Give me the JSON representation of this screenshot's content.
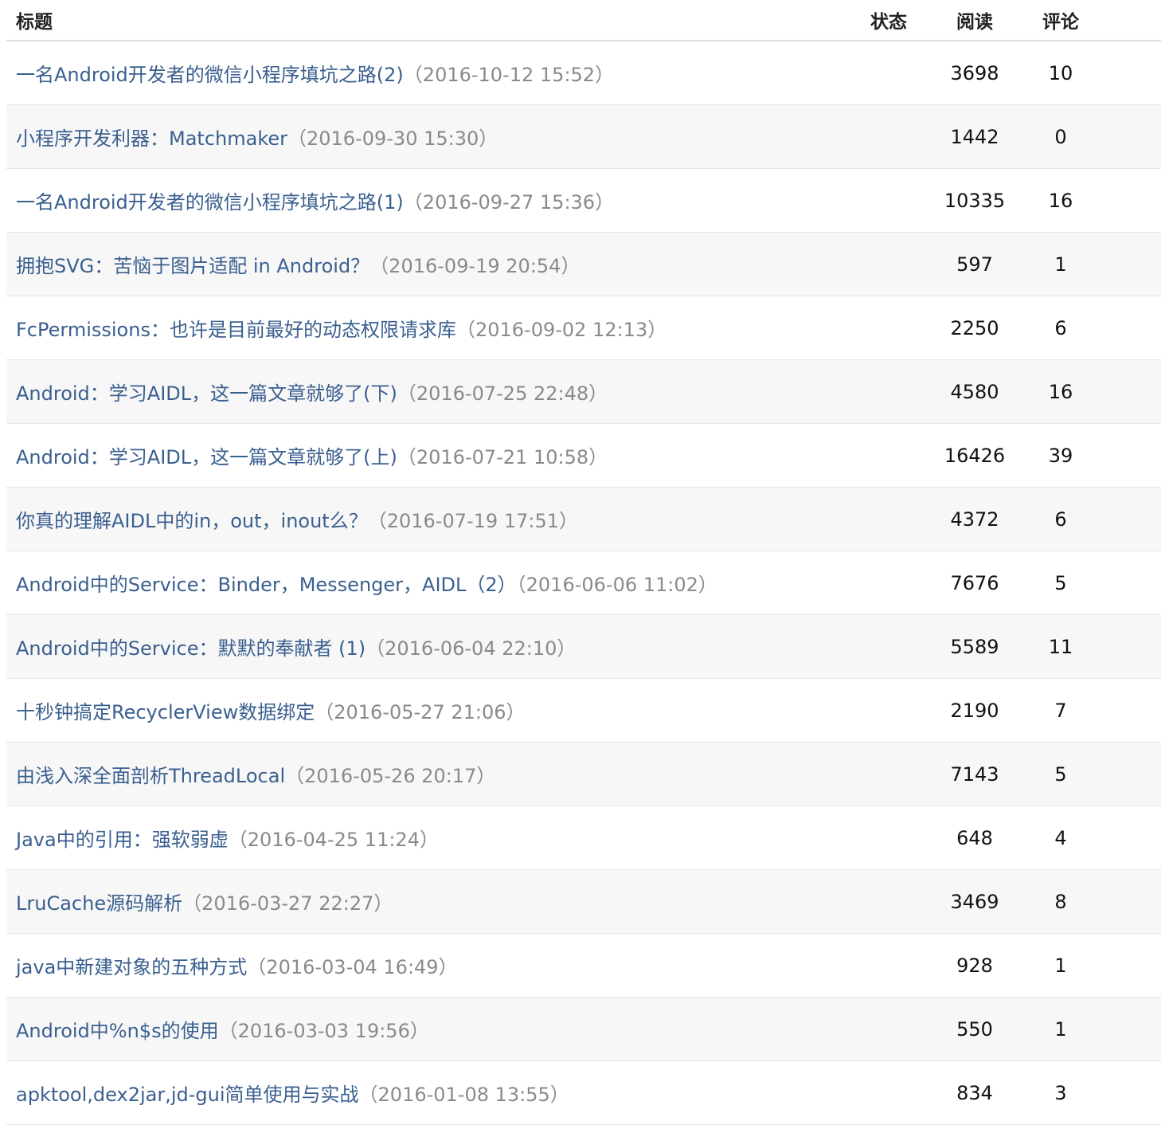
{
  "header": {
    "title": "标题",
    "status": "状态",
    "reads": "阅读",
    "comments": "评论"
  },
  "rows": [
    {
      "title": "一名Android开发者的微信小程序填坑之路(2)",
      "date": "（2016-10-12 15:52）",
      "status": "",
      "reads": "3698",
      "comments": "10"
    },
    {
      "title": "小程序开发利器：Matchmaker",
      "date": "（2016-09-30 15:30）",
      "status": "",
      "reads": "1442",
      "comments": "0"
    },
    {
      "title": "一名Android开发者的微信小程序填坑之路(1)",
      "date": "（2016-09-27 15:36）",
      "status": "",
      "reads": "10335",
      "comments": "16"
    },
    {
      "title": "拥抱SVG：苦恼于图片适配 in Android？",
      "date": "（2016-09-19 20:54）",
      "status": "",
      "reads": "597",
      "comments": "1"
    },
    {
      "title": "FcPermissions：也许是目前最好的动态权限请求库",
      "date": "（2016-09-02 12:13）",
      "status": "",
      "reads": "2250",
      "comments": "6"
    },
    {
      "title": "Android：学习AIDL，这一篇文章就够了(下)",
      "date": "（2016-07-25 22:48）",
      "status": "",
      "reads": "4580",
      "comments": "16"
    },
    {
      "title": "Android：学习AIDL，这一篇文章就够了(上)",
      "date": "（2016-07-21 10:58）",
      "status": "",
      "reads": "16426",
      "comments": "39"
    },
    {
      "title": "你真的理解AIDL中的in，out，inout么？",
      "date": "（2016-07-19 17:51）",
      "status": "",
      "reads": "4372",
      "comments": "6"
    },
    {
      "title": "Android中的Service：Binder，Messenger，AIDL（2）",
      "date": "（2016-06-06 11:02）",
      "status": "",
      "reads": "7676",
      "comments": "5"
    },
    {
      "title": "Android中的Service：默默的奉献者 (1)",
      "date": "（2016-06-04 22:10）",
      "status": "",
      "reads": "5589",
      "comments": "11"
    },
    {
      "title": "十秒钟搞定RecyclerView数据绑定",
      "date": "（2016-05-27 21:06）",
      "status": "",
      "reads": "2190",
      "comments": "7"
    },
    {
      "title": "由浅入深全面剖析ThreadLocal",
      "date": "（2016-05-26 20:17）",
      "status": "",
      "reads": "7143",
      "comments": "5"
    },
    {
      "title": "Java中的引用：强软弱虚",
      "date": "（2016-04-25 11:24）",
      "status": "",
      "reads": "648",
      "comments": "4"
    },
    {
      "title": "LruCache源码解析",
      "date": "（2016-03-27 22:27）",
      "status": "",
      "reads": "3469",
      "comments": "8"
    },
    {
      "title": "java中新建对象的五种方式",
      "date": "（2016-03-04 16:49）",
      "status": "",
      "reads": "928",
      "comments": "1"
    },
    {
      "title": "Android中%n$s的使用",
      "date": "（2016-03-03 19:56）",
      "status": "",
      "reads": "550",
      "comments": "1"
    },
    {
      "title": "apktool,dex2jar,jd-gui简单使用与实战",
      "date": "（2016-01-08 13:55）",
      "status": "",
      "reads": "834",
      "comments": "3"
    }
  ]
}
